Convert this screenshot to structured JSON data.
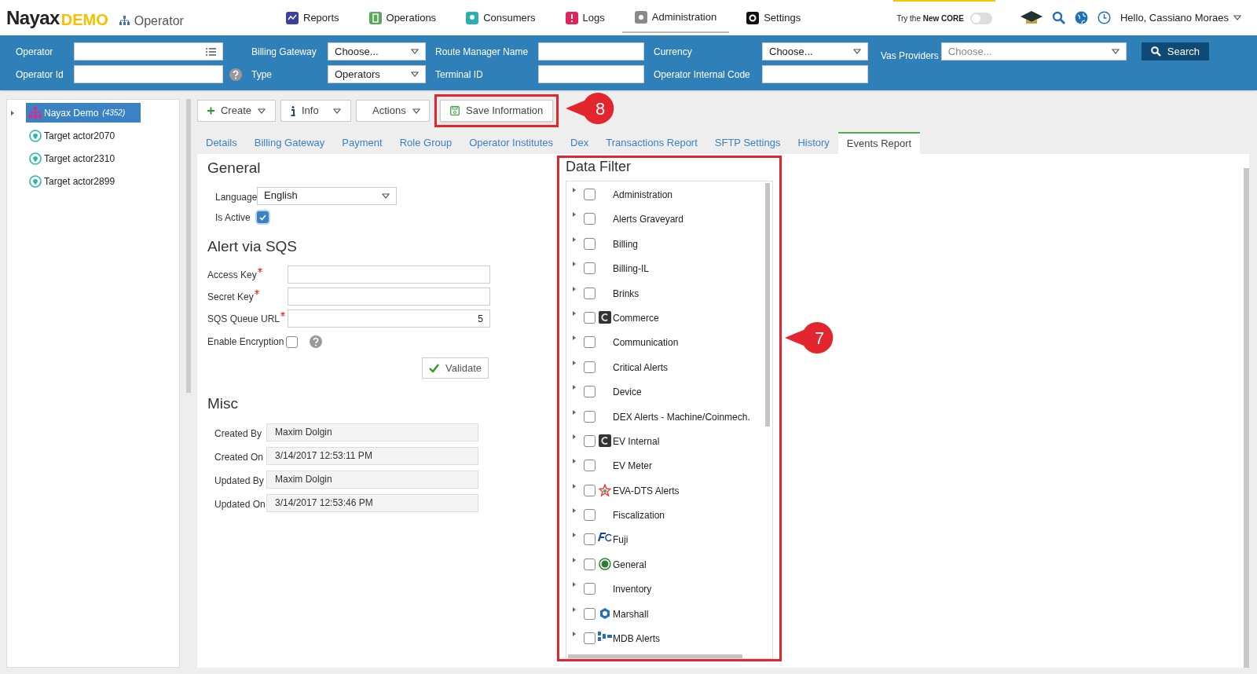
{
  "brand": {
    "name": "Nayax",
    "tag": "DEMO",
    "section": "Operator"
  },
  "nav": [
    {
      "label": "Reports",
      "color": "#3b3f9e",
      "selected": false
    },
    {
      "label": "Operations",
      "color": "#5aa85a",
      "selected": false
    },
    {
      "label": "Consumers",
      "color": "#2bb0b0",
      "selected": false
    },
    {
      "label": "Logs",
      "color": "#e0245e",
      "selected": false
    },
    {
      "label": "Administration",
      "color": "#8a8a8a",
      "selected": true
    },
    {
      "label": "Settings",
      "color": "#111111",
      "selected": false
    }
  ],
  "core_toggle": {
    "label": "Try the **New CORE**",
    "on": false
  },
  "user": {
    "greeting": "Hello, Cassiano Moraes"
  },
  "filters": {
    "operator": {
      "label": "Operator"
    },
    "operator_id": {
      "label": "Operator Id"
    },
    "billing_gateway": {
      "label": "Billing Gateway",
      "value": "Choose..."
    },
    "type": {
      "label": "Type",
      "value": "Operators"
    },
    "route_manager_name": {
      "label": "Route Manager Name"
    },
    "terminal_id": {
      "label": "Terminal ID"
    },
    "currency": {
      "label": "Currency",
      "value": "Choose..."
    },
    "operator_internal_code": {
      "label": "Operator Internal Code"
    },
    "vas_providers": {
      "label": "Vas Providers",
      "placeholder": "Choose..."
    },
    "search_button": "Search"
  },
  "tree": [
    {
      "label": "Nayax Demo",
      "count": "(4352)",
      "kind": "operator",
      "selected": true
    },
    {
      "label": "Target actor2070",
      "kind": "target",
      "selected": false
    },
    {
      "label": "Target actor2310",
      "kind": "target",
      "selected": false
    },
    {
      "label": "Target actor2899",
      "kind": "target",
      "selected": false
    }
  ],
  "toolbar": {
    "create": "Create",
    "info": "Info",
    "actions": "Actions",
    "save": {
      "label": "Save Information",
      "callout": "8"
    }
  },
  "tabs": [
    {
      "label": "Details",
      "selected": false
    },
    {
      "label": "Billing Gateway",
      "selected": false
    },
    {
      "label": "Payment",
      "selected": false
    },
    {
      "label": "Role Group",
      "selected": false
    },
    {
      "label": "Operator Institutes",
      "selected": false
    },
    {
      "label": "Dex",
      "selected": false
    },
    {
      "label": "Transactions Report",
      "selected": false
    },
    {
      "label": "SFTP Settings",
      "selected": false
    },
    {
      "label": "History",
      "selected": false
    },
    {
      "label": "Events Report",
      "selected": true
    }
  ],
  "general": {
    "title": "General",
    "language": {
      "label": "Language",
      "value": "English"
    },
    "is_active": {
      "label": "Is Active",
      "checked": true
    }
  },
  "sqs": {
    "title": "Alert via SQS",
    "fields": [
      {
        "label": "Access Key",
        "required": true
      },
      {
        "label": "Secret Key",
        "required": true
      },
      {
        "label": "SQS Queue URL",
        "required": true,
        "value": "5"
      }
    ],
    "encryption": {
      "label": "Enable Encryption",
      "checked": false
    },
    "validate": "Validate"
  },
  "misc": {
    "title": "Misc",
    "fields": [
      {
        "label": "Created By",
        "value": "Maxim Dolgin"
      },
      {
        "label": "Created On",
        "value": "3/14/2017 12:53:11 PM"
      },
      {
        "label": "Updated By",
        "value": "Maxim Dolgin"
      },
      {
        "label": "Updated On",
        "value": "3/14/2017 12:53:46 PM"
      }
    ]
  },
  "data_filter": {
    "title": "Data Filter",
    "callout": "7",
    "items": [
      {
        "label": "Administration",
        "kind": "plain",
        "checked": false
      },
      {
        "label": "Alerts Graveyard",
        "kind": "plain",
        "checked": false
      },
      {
        "label": "Billing",
        "kind": "plain",
        "checked": false
      },
      {
        "label": "Billing-IL",
        "kind": "plain",
        "checked": false
      },
      {
        "label": "Brinks",
        "kind": "plain",
        "checked": false
      },
      {
        "label": "Commerce",
        "kind": "tile",
        "checked": false
      },
      {
        "label": "Communication",
        "kind": "plain",
        "checked": false
      },
      {
        "label": "Critical Alerts",
        "kind": "plain",
        "checked": false
      },
      {
        "label": "Device",
        "kind": "plain",
        "checked": false
      },
      {
        "label": "DEX Alerts - Machine/Coinmech.",
        "kind": "plain",
        "checked": false
      },
      {
        "label": "EV Internal",
        "kind": "tile",
        "checked": false
      },
      {
        "label": "EV Meter",
        "kind": "plain",
        "checked": false
      },
      {
        "label": "EVA-DTS Alerts",
        "kind": "star",
        "checked": false
      },
      {
        "label": "Fiscalization",
        "kind": "plain",
        "checked": false
      },
      {
        "label": "Fuji",
        "kind": "swoosh",
        "checked": false
      },
      {
        "label": "General",
        "kind": "ring",
        "checked": false
      },
      {
        "label": "Inventory",
        "kind": "plain",
        "checked": false
      },
      {
        "label": "Marshall",
        "kind": "cube",
        "checked": false
      },
      {
        "label": "MDB Alerts",
        "kind": "blocks",
        "checked": false
      }
    ]
  }
}
